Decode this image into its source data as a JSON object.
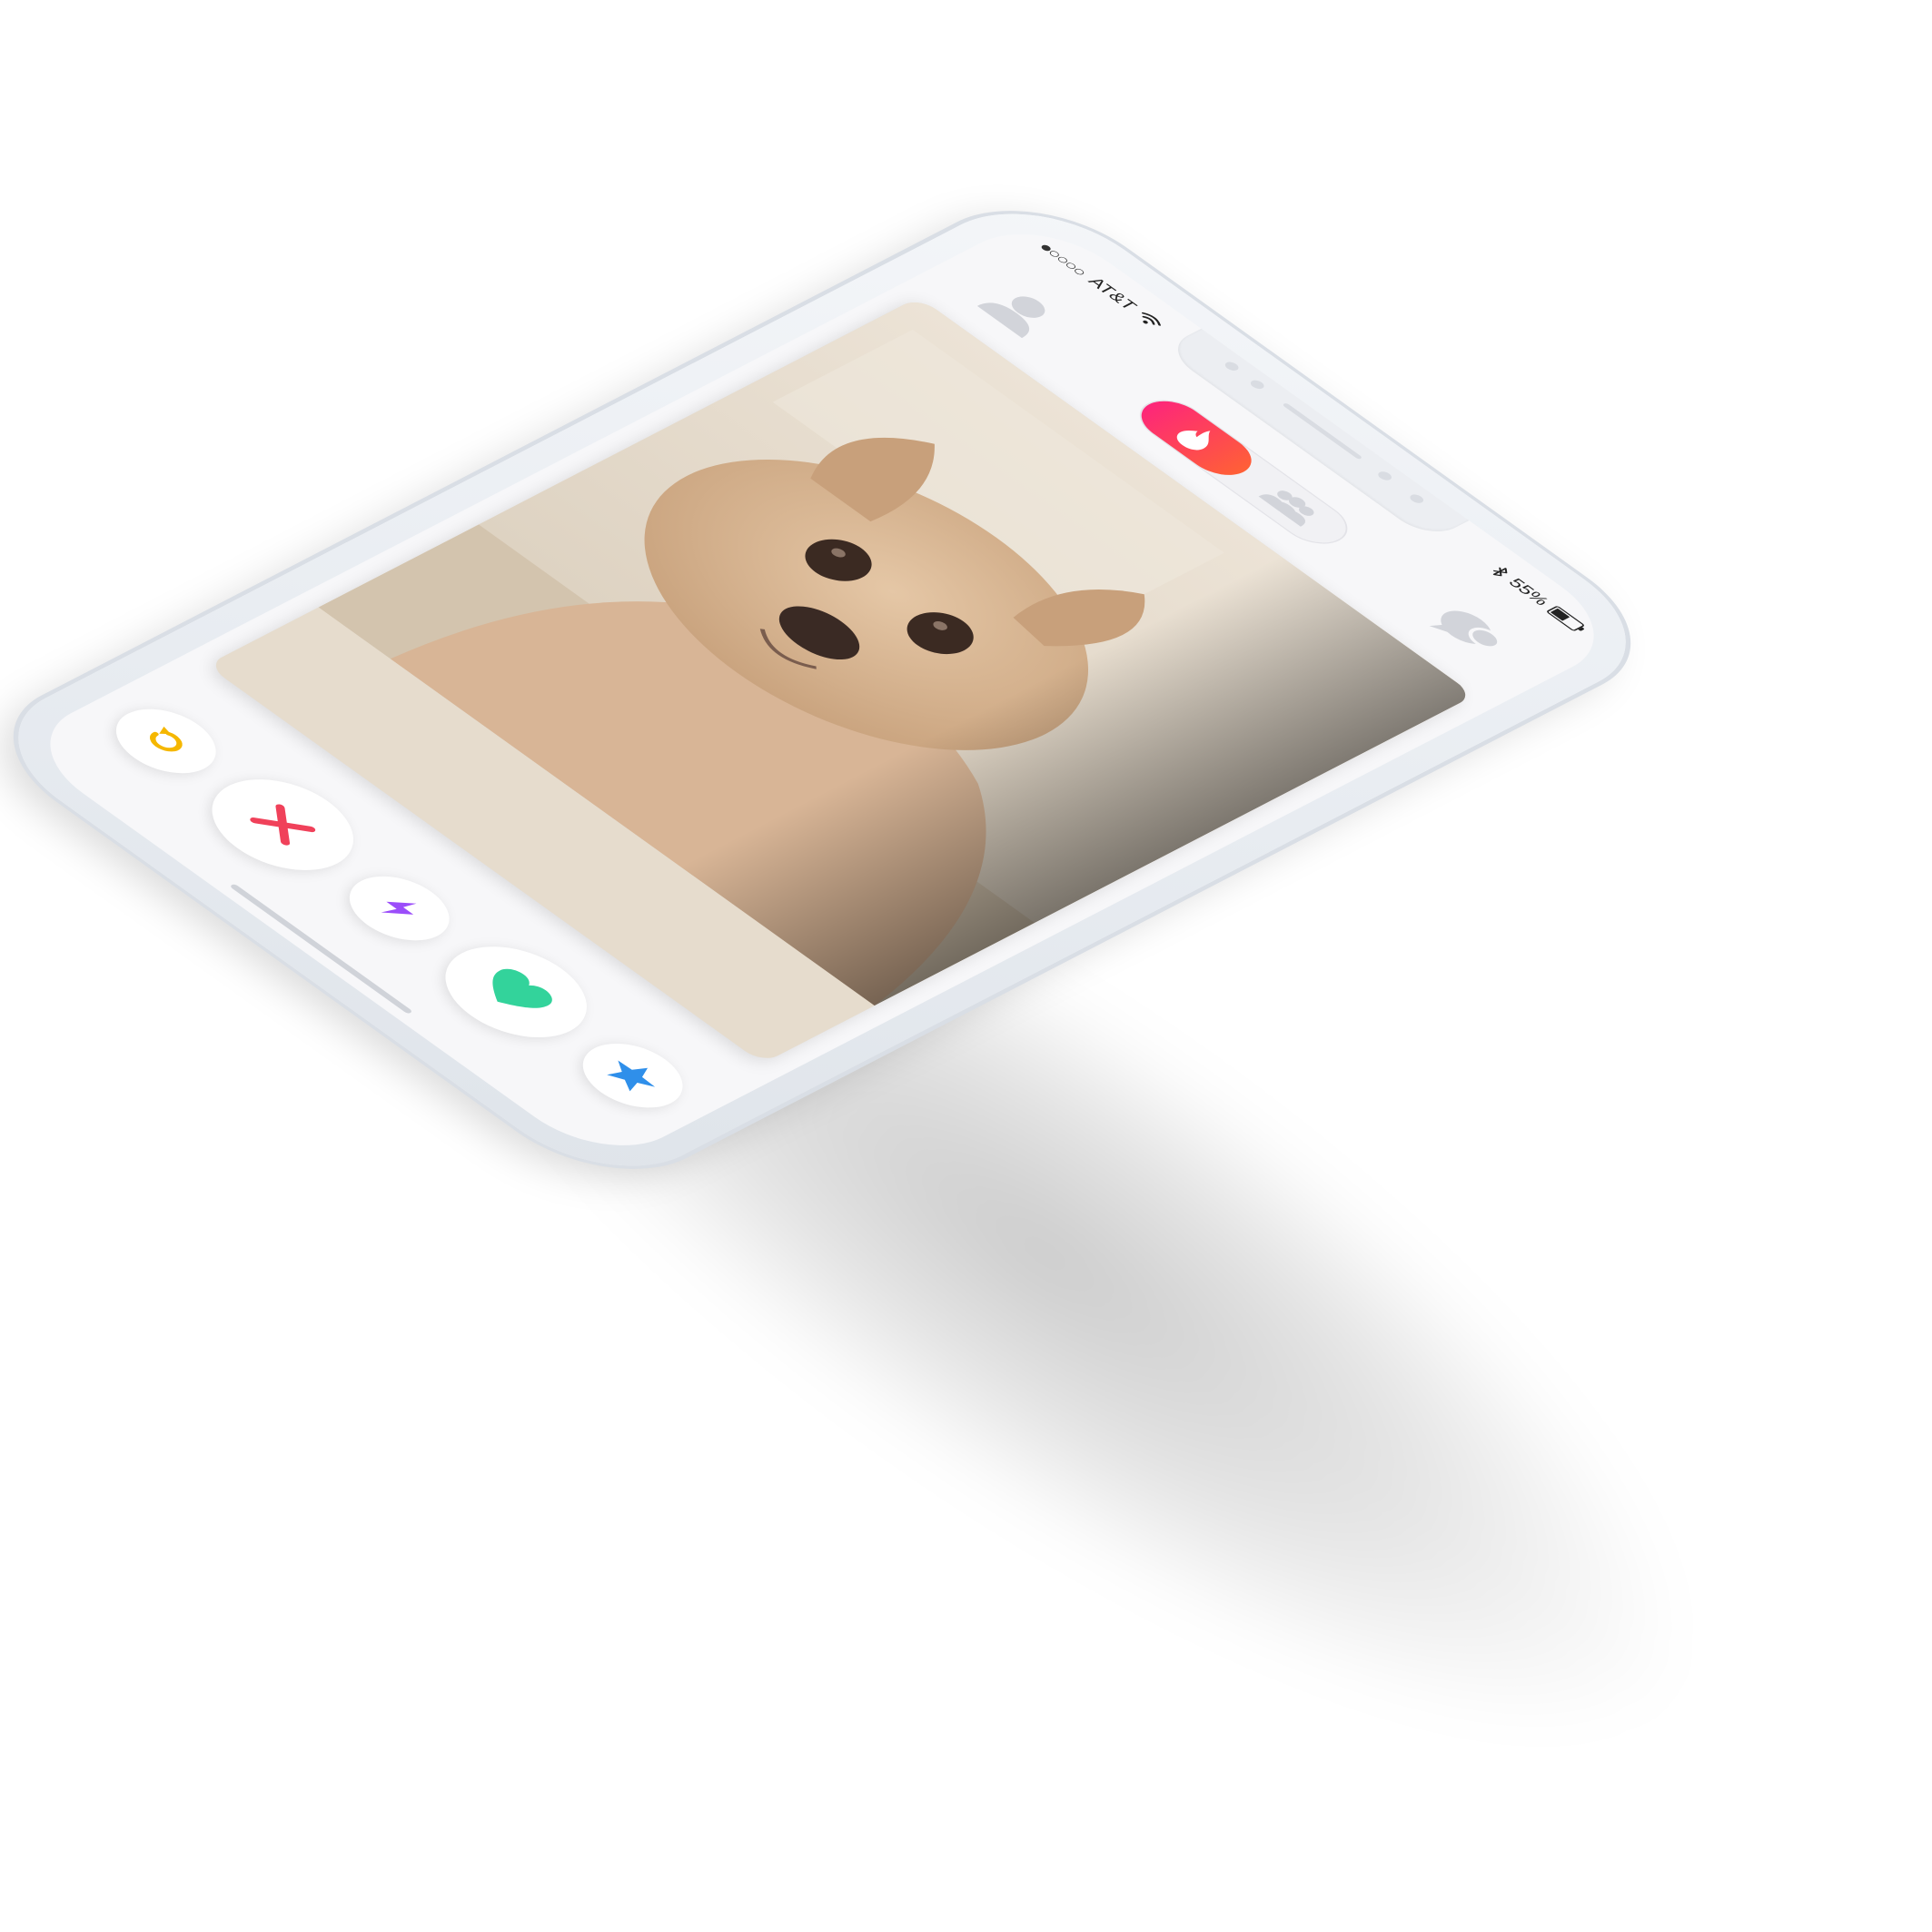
{
  "status_bar": {
    "carrier": "AT&T",
    "signal_bars_on": 1,
    "signal_bars_total": 5,
    "battery_percent": "55%",
    "battery_level": 0.55
  },
  "top_nav": {
    "profile_icon": "profile-icon",
    "fire_icon": "flame-icon",
    "social_icon": "group-icon",
    "messages_icon": "chat-bubbles-icon",
    "active_tab": "flame"
  },
  "colors": {
    "toggle_gradient_start": "#fd267a",
    "toggle_gradient_end": "#ff6036",
    "rewind": "#f5b700",
    "nope": "#f0415a",
    "boost": "#9b4dfa",
    "like": "#33d39b",
    "super_like": "#2f8fea",
    "inactive_icon": "#d2d4da"
  },
  "actions": [
    {
      "id": "rewind",
      "icon": "rewind-icon"
    },
    {
      "id": "nope",
      "icon": "close-x-icon"
    },
    {
      "id": "boost",
      "icon": "lightning-bolt-icon"
    },
    {
      "id": "like",
      "icon": "heart-icon"
    },
    {
      "id": "super_like",
      "icon": "star-icon"
    }
  ]
}
